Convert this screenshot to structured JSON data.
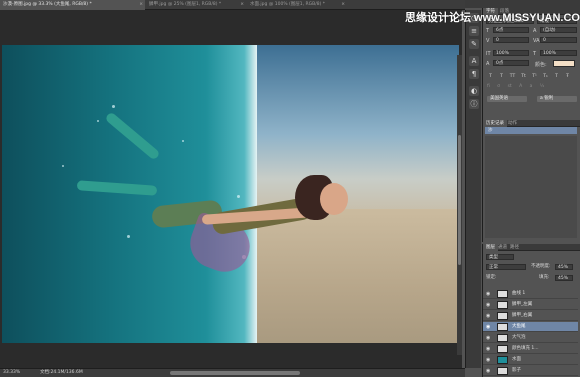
{
  "tabs": [
    {
      "label": "沙漠-原图.jpg @ 33.3% (大鱼尾, RGB/8) *",
      "active": true
    },
    {
      "label": "鳞甲.jpg @ 25% (图层1, RGB/8) *",
      "active": false
    },
    {
      "label": "水面.jpg @ 100% (图层1, RGB/8) *",
      "active": false
    }
  ],
  "watermark": "思缘设计论坛  www.MISSYUAN.COM",
  "status": {
    "zoom": "33.33%",
    "doc": "文档:24.1M/136.6M"
  },
  "character_panel": {
    "tabs": [
      "字符",
      "段落"
    ],
    "font_family": "方正兰亭黑_GBK",
    "font_style": "常规",
    "font_size": "6点",
    "leading": "(自动)",
    "kerning": "0",
    "tracking": "0",
    "vscale": "100%",
    "hscale": "100%",
    "baseline": "0点",
    "color_label": "颜色:",
    "format_buttons": [
      "T",
      "T",
      "TT",
      "Tt",
      "T¹",
      "T₁",
      "T",
      "Ŧ"
    ],
    "language": "美国英语",
    "antialias": "a 锐利"
  },
  "history_panel": {
    "tabs": [
      "历史记录",
      "动作"
    ],
    "selected_item": "沙"
  },
  "layers_panel": {
    "tabs": [
      "图层",
      "通道",
      "路径"
    ],
    "filter": "类型",
    "blend_mode": "正常",
    "opacity_label": "不透明度:",
    "opacity": "45%",
    "lock_label": "锁定:",
    "fill_label": "填充:",
    "fill": "45%",
    "layers": [
      {
        "name": "曲线 1",
        "selected": false
      },
      {
        "name": "鳞甲_左翼",
        "selected": false
      },
      {
        "name": "鳞甲_右翼",
        "selected": false
      },
      {
        "name": "大鱼尾",
        "selected": true
      },
      {
        "name": "大气泡",
        "selected": false
      },
      {
        "name": "颜色填充 1...",
        "selected": false
      },
      {
        "name": "水面",
        "selected": false
      },
      {
        "name": "影子",
        "selected": false
      }
    ]
  },
  "colors": {
    "selection": "#6f86a6",
    "panel_bg": "#535353",
    "swatch": "#f4dfc6"
  }
}
